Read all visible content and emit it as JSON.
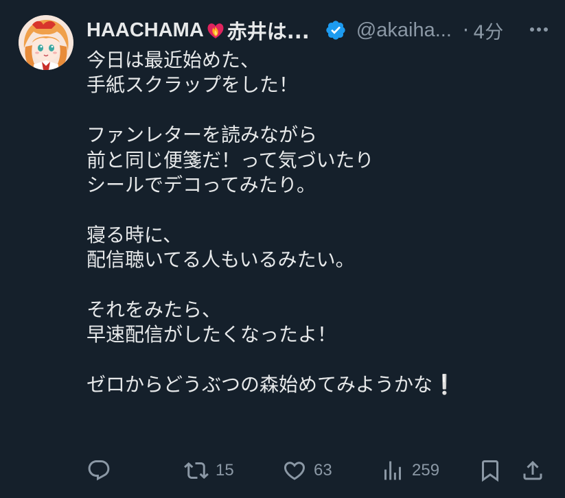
{
  "tweet": {
    "author": {
      "display_name_latin": "HAACHAMA",
      "display_name_jp": "赤井は...",
      "handle": "@akaiha...",
      "verified_color": "#1d9bf0",
      "avatar_icon": "avatar-image"
    },
    "separator": "·",
    "timestamp": "4分",
    "more_icon": "more-icon",
    "text": "今日は最近始めた、\n手紙スクラップをした！\n\nファンレターを読みながら\n前と同じ便箋だ！って気づいたり\nシールでデコってみたり。\n\n寝る時に、\n配信聴いてる人もいるみたい。\n\nそれをみたら、\n早速配信がしたくなったよ！\n\nゼロからどうぶつの森始めてみようかな❕",
    "actions": {
      "reply": {
        "icon": "reply-icon",
        "count": ""
      },
      "retweet": {
        "icon": "retweet-icon",
        "count": "15"
      },
      "like": {
        "icon": "like-icon",
        "count": "63"
      },
      "views": {
        "icon": "views-icon",
        "count": "259"
      },
      "bookmark": {
        "icon": "bookmark-icon"
      },
      "share": {
        "icon": "share-icon"
      }
    }
  },
  "colors": {
    "background": "#15202b",
    "text": "#e7e9ea",
    "secondary": "#8b98a5",
    "accent": "#1d9bf0"
  }
}
